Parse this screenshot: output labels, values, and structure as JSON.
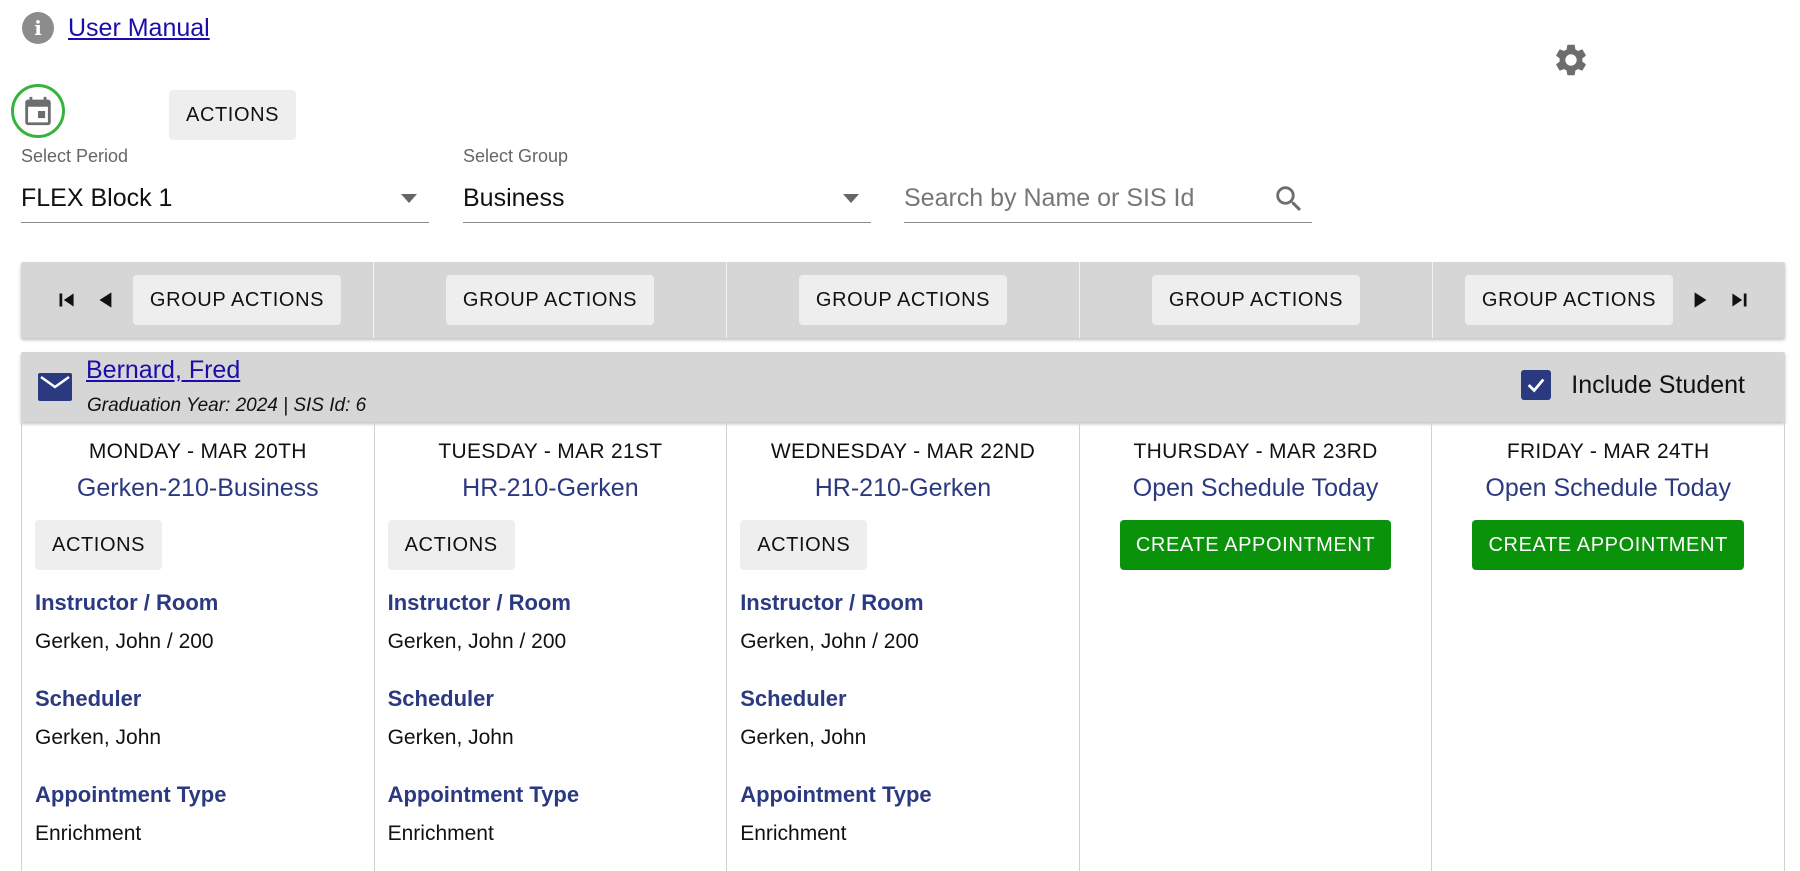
{
  "header": {
    "manual_link": "User Manual",
    "actions_label": "ACTIONS"
  },
  "filters": {
    "period_label": "Select Period",
    "period_value": "FLEX Block 1",
    "group_label": "Select Group",
    "group_value": "Business",
    "search_placeholder": "Search by Name or SIS Id"
  },
  "group_actions": [
    "GROUP ACTIONS",
    "GROUP ACTIONS",
    "GROUP ACTIONS",
    "GROUP ACTIONS",
    "GROUP ACTIONS"
  ],
  "student": {
    "name": "Bernard, Fred",
    "meta": "Graduation Year: 2024  |  SIS Id: 6",
    "include_label": "Include Student"
  },
  "labels": {
    "instructor": "Instructor / Room",
    "scheduler": "Scheduler",
    "appointment_type": "Appointment Type",
    "actions": "ACTIONS",
    "create": "CREATE APPOINTMENT"
  },
  "days": [
    {
      "title": "MONDAY - MAR 20TH",
      "subtitle": "Gerken-210-Business",
      "instructor": "Gerken, John / 200",
      "scheduler": "Gerken, John",
      "type": "Enrichment"
    },
    {
      "title": "TUESDAY - MAR 21ST",
      "subtitle": "HR-210-Gerken",
      "instructor": "Gerken, John / 200",
      "scheduler": "Gerken, John",
      "type": "Enrichment"
    },
    {
      "title": "WEDNESDAY - MAR 22ND",
      "subtitle": "HR-210-Gerken",
      "instructor": "Gerken, John / 200",
      "scheduler": "Gerken, John",
      "type": "Enrichment"
    },
    {
      "title": "THURSDAY - MAR 23RD",
      "subtitle": "Open Schedule Today"
    },
    {
      "title": "FRIDAY - MAR 24TH",
      "subtitle": "Open Schedule Today"
    }
  ],
  "colors": {
    "accent_blue": "#2b3a80",
    "create_green": "#0a930a",
    "bar_grey": "#d6d6d6",
    "highlight_ring": "#36b33c"
  }
}
